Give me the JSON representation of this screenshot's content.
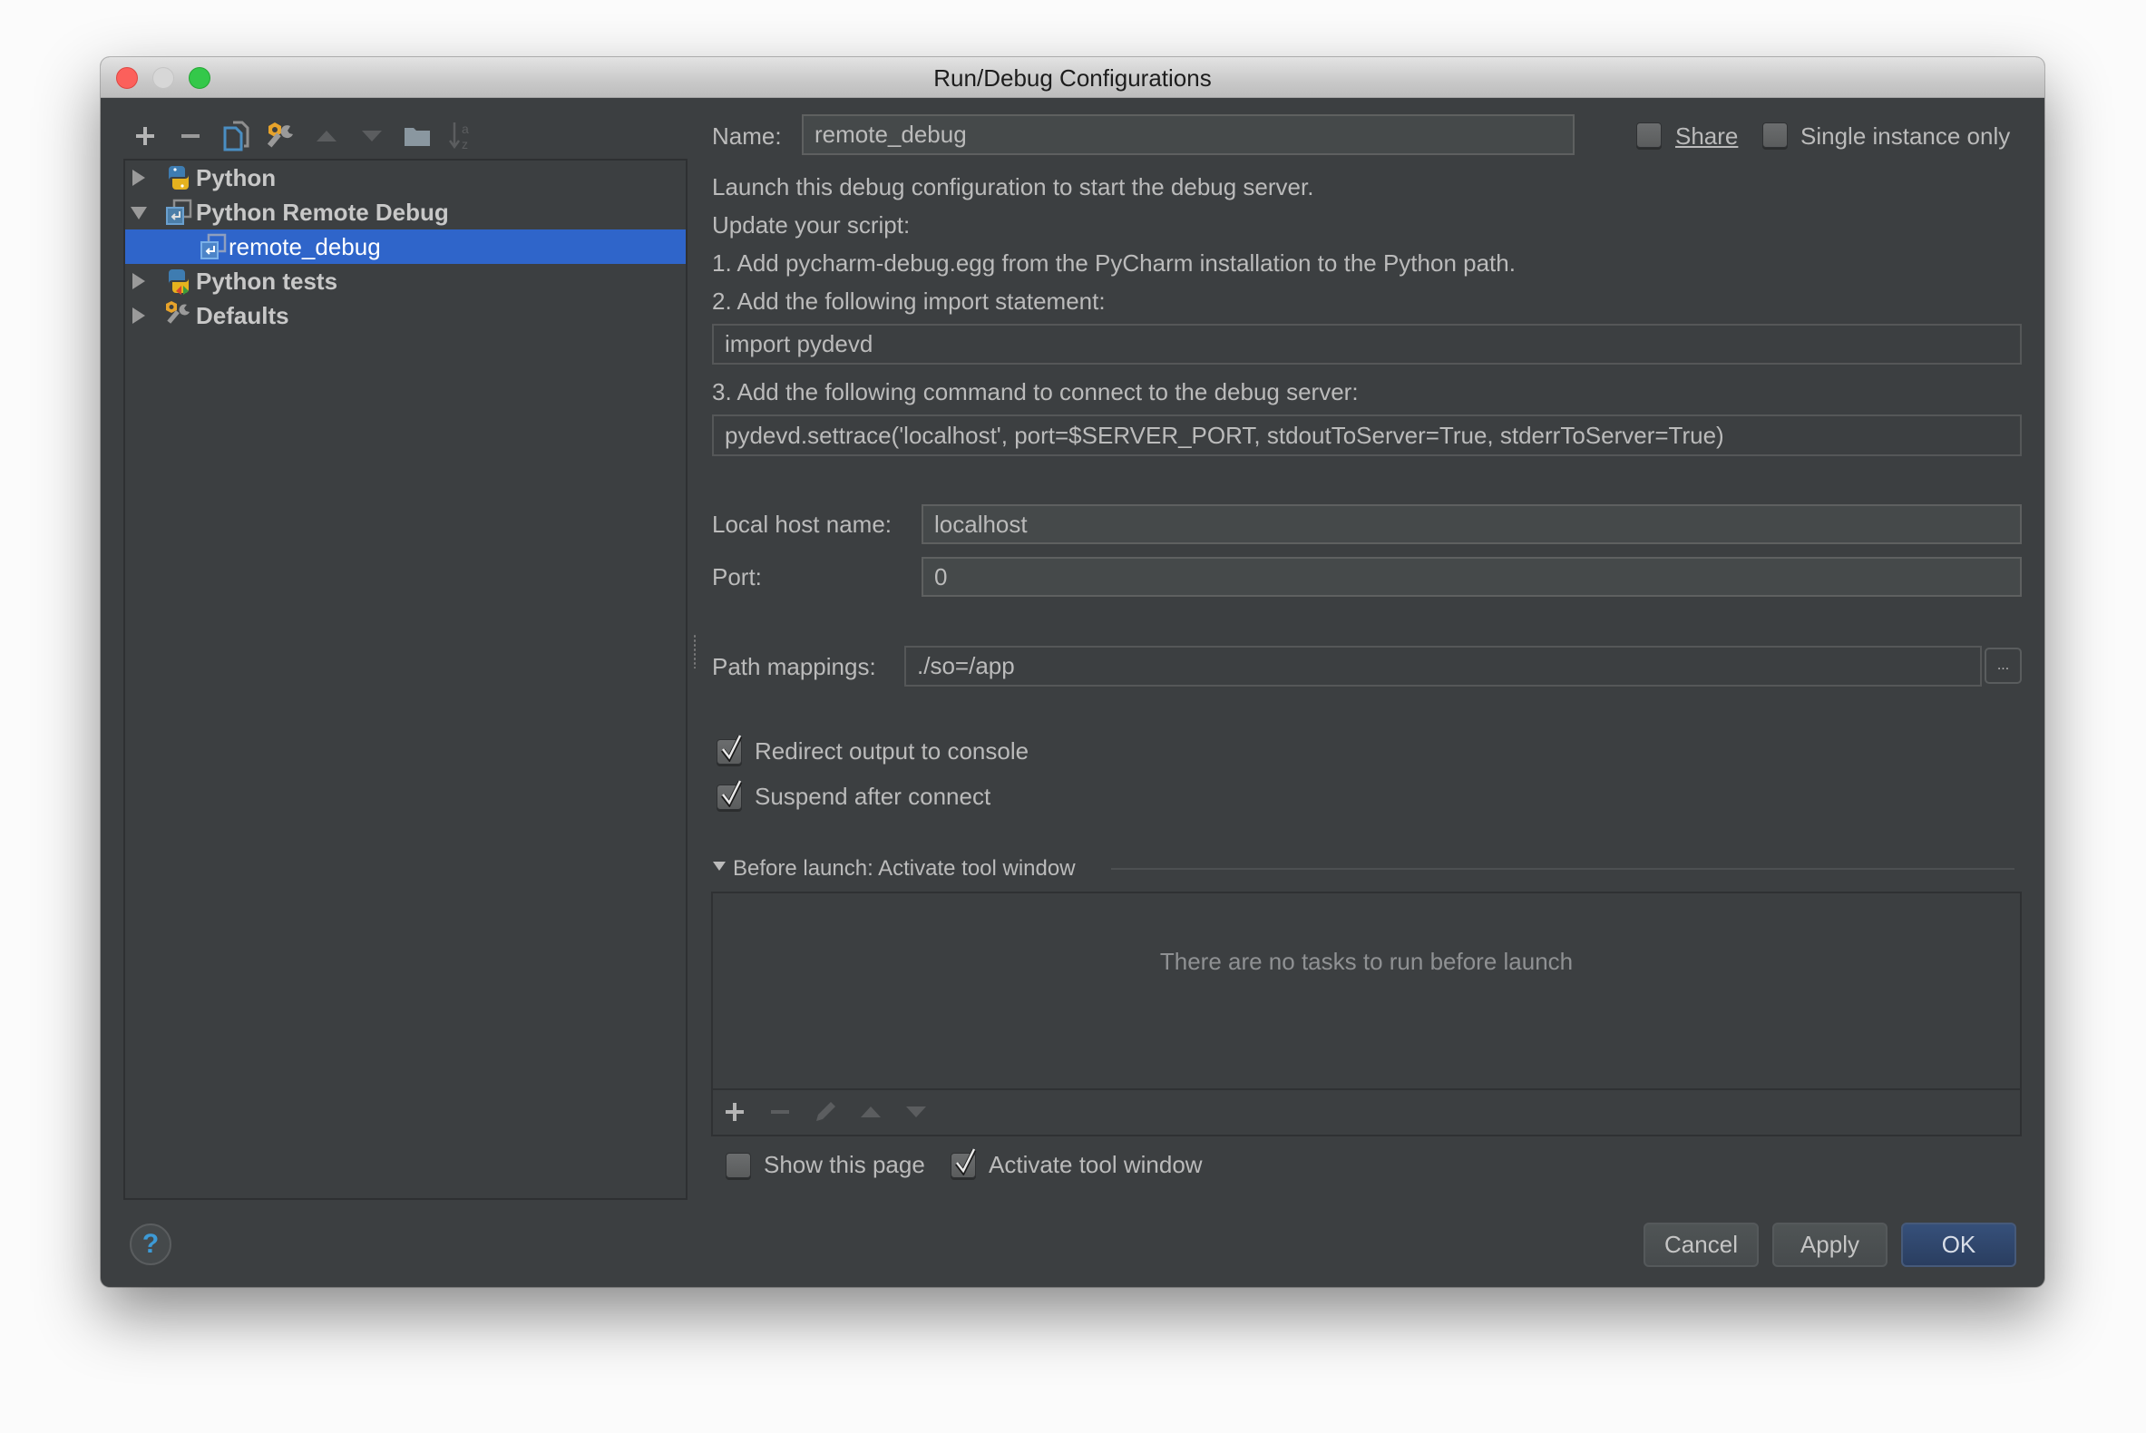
{
  "window": {
    "title": "Run/Debug Configurations"
  },
  "tree_toolbar": {
    "icons": [
      "add-icon",
      "remove-icon",
      "copy-icon",
      "edit-defaults-icon",
      "move-up-icon",
      "move-down-icon",
      "folder-icon",
      "sort-icon"
    ]
  },
  "tree": {
    "items": [
      {
        "label": "Python",
        "expanded": false,
        "icon": "python-icon"
      },
      {
        "label": "Python Remote Debug",
        "expanded": true,
        "icon": "remote-debug-icon"
      },
      {
        "label": "remote_debug",
        "selected": true,
        "icon": "remote-debug-icon"
      },
      {
        "label": "Python tests",
        "expanded": false,
        "icon": "python-tests-icon"
      },
      {
        "label": "Defaults",
        "expanded": false,
        "icon": "defaults-wrench-icon"
      }
    ]
  },
  "config": {
    "name_label": "Name:",
    "name_value": "remote_debug",
    "share_label": "Share",
    "share_checked": false,
    "single_instance_label": "Single instance only",
    "single_instance_checked": false,
    "instructions": {
      "line1": "Launch this debug configuration to start the debug server.",
      "line2": "Update your script:",
      "step1": "1. Add pycharm-debug.egg from the PyCharm installation to the Python path.",
      "step2": "2. Add the following import statement:",
      "import_code": "import pydevd",
      "step3": "3. Add the following command to connect to the debug server:",
      "settrace_code": "pydevd.settrace('localhost', port=$SERVER_PORT, stdoutToServer=True, stderrToServer=True)"
    },
    "local_host_label": "Local host name:",
    "local_host_value": "localhost",
    "port_label": "Port:",
    "port_value": "0",
    "path_mappings_label": "Path mappings:",
    "path_mappings_value": "./so=/app",
    "path_mappings_browse": "...",
    "redirect_output_label": "Redirect output to console",
    "redirect_output_checked": true,
    "suspend_label": "Suspend after connect",
    "suspend_checked": true
  },
  "before_launch": {
    "header": "Before launch: Activate tool window",
    "empty_text": "There are no tasks to run before launch",
    "toolbar_icons": [
      "add-icon",
      "remove-icon",
      "edit-icon",
      "move-up-icon",
      "move-down-icon"
    ],
    "show_page_label": "Show this page",
    "show_page_checked": false,
    "activate_tool_window_label": "Activate tool window",
    "activate_tool_window_checked": true
  },
  "footer": {
    "help_label": "?",
    "cancel_label": "Cancel",
    "apply_label": "Apply",
    "ok_label": "OK"
  },
  "colors": {
    "background": "#3c3f41",
    "selection": "#2f65ca",
    "ok_button": "#2f4467",
    "help_icon": "#3d9ad6"
  }
}
